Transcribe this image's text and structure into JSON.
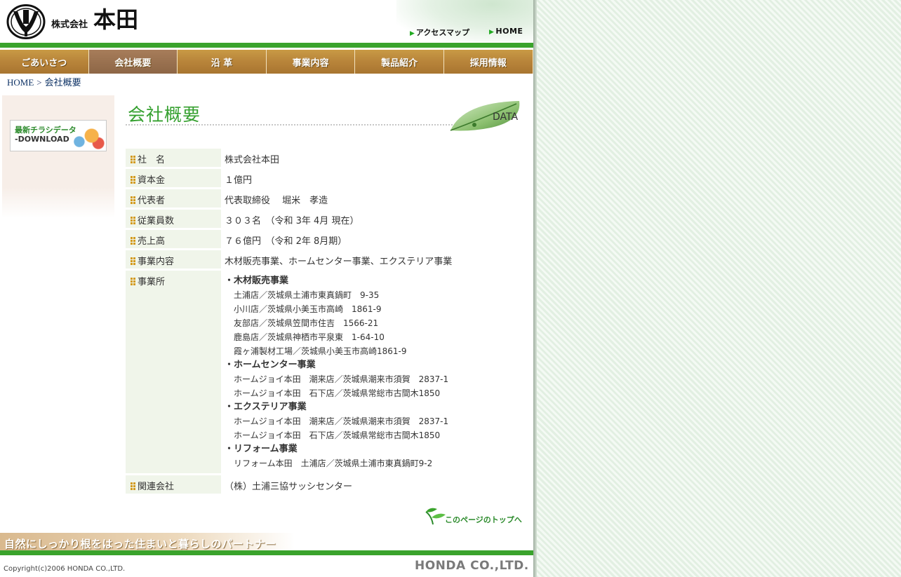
{
  "header": {
    "logo_small": "株式会社",
    "logo_big": "本田",
    "access_link": "アクセスマップ",
    "home_link": "HOME"
  },
  "nav": {
    "items": [
      {
        "label": "ごあいさつ"
      },
      {
        "label": "会社概要"
      },
      {
        "label": "沿 革"
      },
      {
        "label": "事業内容"
      },
      {
        "label": "製品紹介"
      },
      {
        "label": "採用情報"
      }
    ],
    "active_index": 1
  },
  "breadcrumb": {
    "home": "HOME",
    "separator": ">",
    "current": "会社概要"
  },
  "sidebar": {
    "download_line1": "最新チラシデータ",
    "download_line2": "-DOWNLOAD"
  },
  "main": {
    "title": "会社概要",
    "badge": "DATA"
  },
  "company": {
    "rows": [
      {
        "label": "社　名",
        "value": "株式会社本田"
      },
      {
        "label": "資本金",
        "value": "１億円"
      },
      {
        "label": "代表者",
        "value": "代表取締役　 堀米　孝造"
      },
      {
        "label": "従業員数",
        "value": "３０３名　（令和 3年 4月 現在）"
      },
      {
        "label": "売上高",
        "value": "７６億円　（令和 2年 8月期）"
      },
      {
        "label": "事業内容",
        "value": "木材販売事業、ホームセンター事業、エクステリア事業"
      }
    ],
    "offices_label": "事業所",
    "offices": [
      {
        "heading": "・木材販売事業",
        "lines": [
          "土浦店／茨城県土浦市東真鍋町　9-35",
          "小川店／茨城県小美玉市高崎　1861-9",
          "友部店／茨城県笠間市住吉　1566-21",
          "鹿島店／茨城県神栖市平泉東　1-64-10",
          "霞ヶ浦製材工場／茨城県小美玉市高崎1861-9"
        ]
      },
      {
        "heading": "・ホームセンター事業",
        "lines": [
          "ホームジョイ本田　潮来店／茨城県潮来市須賀　2837-1",
          "ホームジョイ本田　石下店／茨城県常総市古間木1850"
        ]
      },
      {
        "heading": "・エクステリア事業",
        "lines": [
          "ホームジョイ本田　潮来店／茨城県潮来市須賀　2837-1",
          "ホームジョイ本田　石下店／茨城県常総市古間木1850"
        ]
      },
      {
        "heading": "・リフォーム事業",
        "lines": [
          "リフォーム本田　土浦店／茨城県土浦市東真鍋町9-2"
        ]
      }
    ],
    "related_label": "関連会社",
    "related_value": "（株）土浦三協サッシセンター"
  },
  "pagetop": "このページのトップへ",
  "footer": {
    "slogan": "自然にしっかり根をはった住まいと暮らしのパートナー",
    "copyright": "Copyright(c)2006 HONDA CO.,LTD.",
    "brand": "HONDA CO.,LTD."
  },
  "colors": {
    "accent_green": "#3aa32c",
    "nav_brown": "#b8843a",
    "row_label_bg": "#f0f5ea",
    "bullet_gold": "#d39a1c"
  }
}
